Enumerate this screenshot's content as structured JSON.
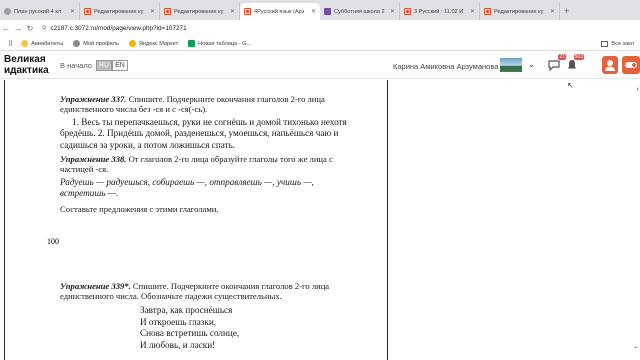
{
  "tabs": [
    {
      "title": "План русский 4 кл",
      "icon": "gray",
      "active": false
    },
    {
      "title": "Редактирование ку",
      "icon": "moodle",
      "active": false
    },
    {
      "title": "Редактирование ку",
      "icon": "moodle",
      "active": false
    },
    {
      "title": "4Русский язык (Арз",
      "icon": "moodle",
      "active": true
    },
    {
      "title": "Субботняя школа 2",
      "icon": "purple",
      "active": false
    },
    {
      "title": "3 Русский : 11.02 И",
      "icon": "moodle",
      "active": false
    },
    {
      "title": "Редактирование ку",
      "icon": "moodle",
      "active": false
    }
  ],
  "address": {
    "url": "c2187.c.3072.ru/mod/page/view.php?id=107271"
  },
  "bookmarks": {
    "items": [
      "Авиабилеты",
      "Мой профиль",
      "Яндекс Маркет",
      "Новая таблица - G..."
    ],
    "all": "Все закл"
  },
  "header": {
    "logo_line1": "Великая",
    "logo_line2": "идактика",
    "home": "В начало",
    "lang_ru": "RU",
    "lang_en": "EN",
    "user": "Карина Амиковна Арзуманова",
    "notif_count": "21",
    "msg_count": "503"
  },
  "book": {
    "ex337_title": "Упражнение 337.",
    "ex337_task": "Спишите. Подчеркните окончания глаголов 2-го лица единственного числа без -ся и с -ся(-сь).",
    "ex337_text": "1. Весь ты перепачкаешься, руки не согнёшь и домой тихонько нехотя бредёшь. 2. Придёшь домой, разденешься, умоешься, напьёшься чаю и садишься за уроки, а потом ложишься спать.",
    "ex338_title": "Упражнение 338.",
    "ex338_task": "От глаголов 2-го лица образуйте глаголы того же лица с частицей -ся.",
    "ex338_examples": "Радуешь — радуешься, собираешь —, отправляешь —, учишь —, встретишь —.",
    "ex338_note": "Составьте предложения с этими глаголами.",
    "page_number": "100",
    "ex339_title": "Упражнение 339*.",
    "ex339_task": "Спишите. Подчеркните окончания глаголов 2-го лица единственного числа. Обозначьте падежи существительных.",
    "poem": [
      "Завтра, как проснёшься",
      "И откроешь глазки,",
      "Снова встретишь солнце,",
      "И любовь, и ласки!"
    ]
  },
  "colors": {
    "moodle": "#e84b2e",
    "badge": "#d9534f"
  }
}
